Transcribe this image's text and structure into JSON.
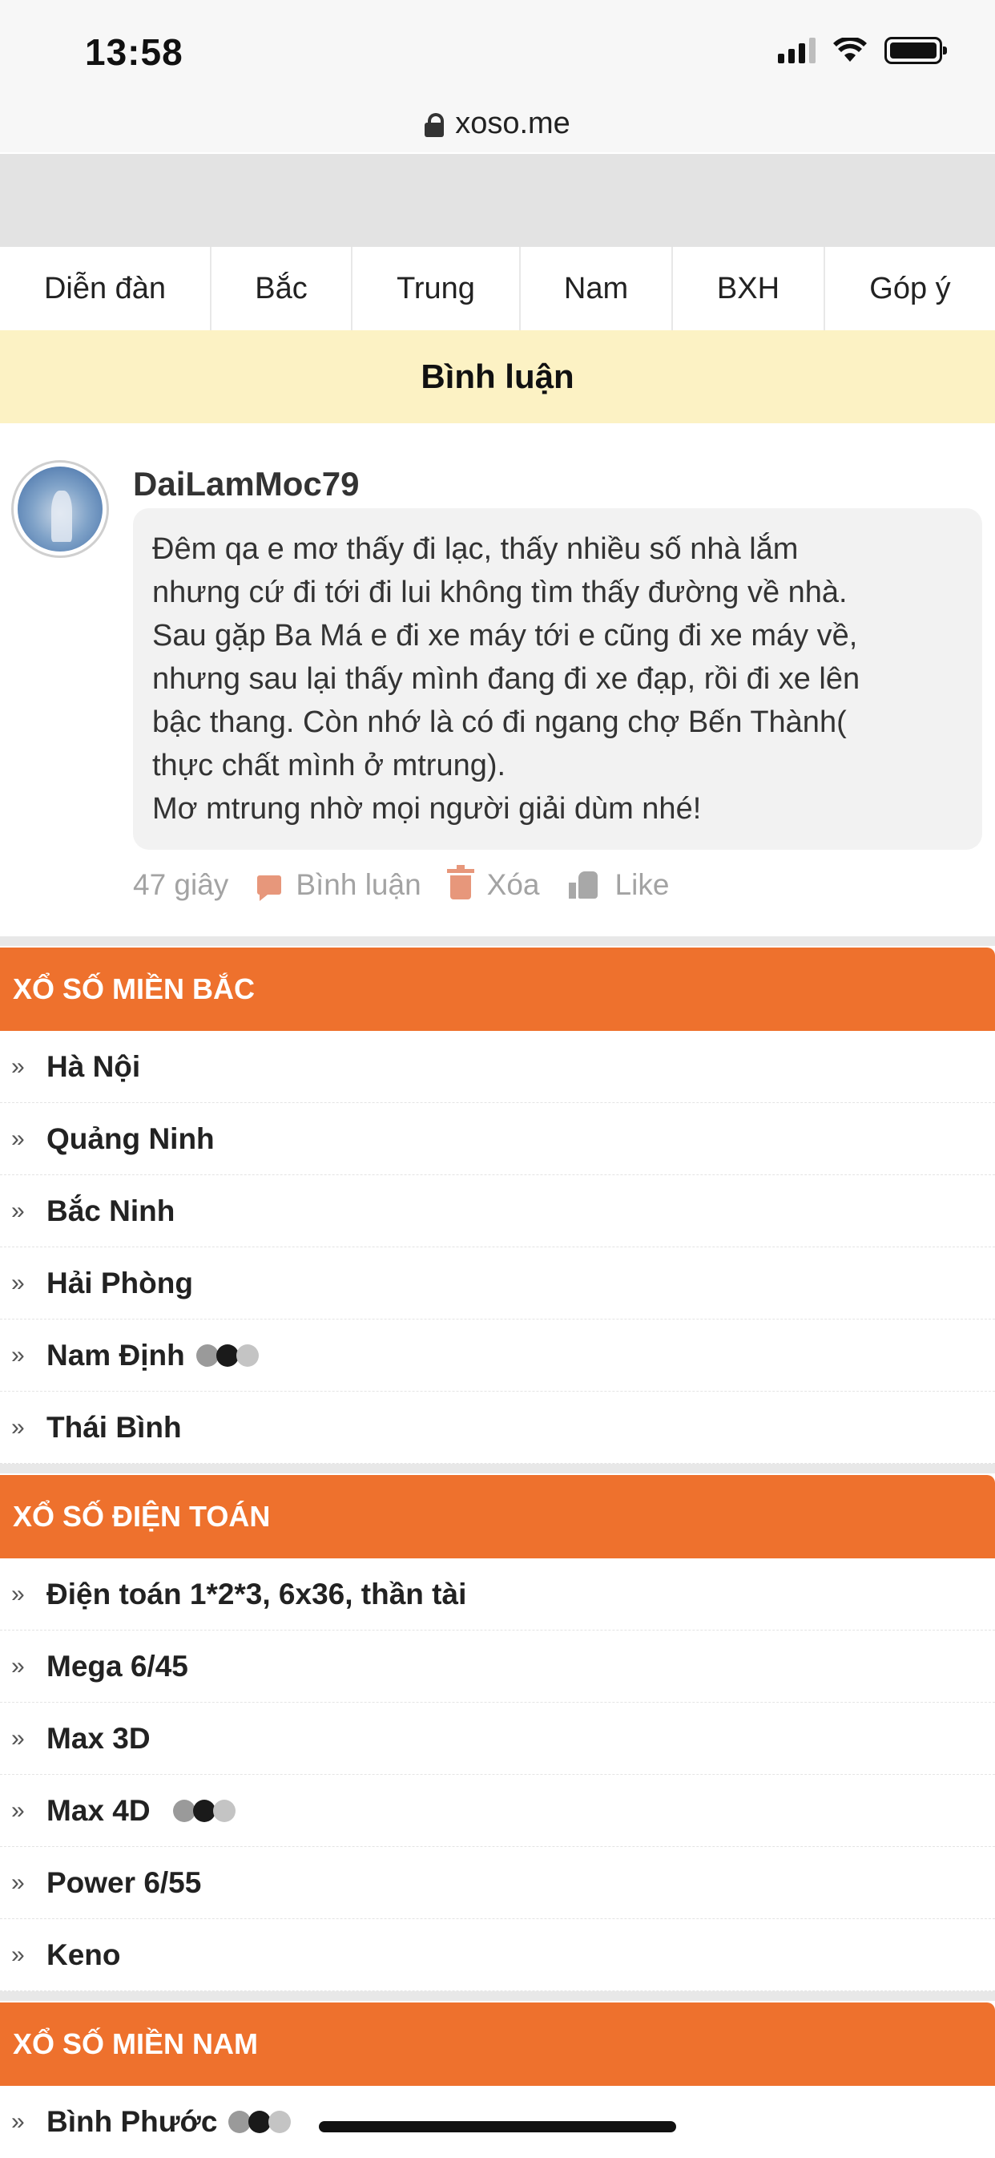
{
  "status_bar": {
    "time": "13:58"
  },
  "browser": {
    "url": "xoso.me"
  },
  "nav": {
    "items": [
      {
        "label": "Diễn đàn"
      },
      {
        "label": "Bắc"
      },
      {
        "label": "Trung"
      },
      {
        "label": "Nam"
      },
      {
        "label": "BXH"
      },
      {
        "label": "Góp ý"
      }
    ]
  },
  "section_title": "Bình luận",
  "comment": {
    "username": "DaiLamMoc79",
    "text": "Đêm qa e mơ thấy đi lạc, thấy nhiều số nhà lắm\nnhưng cứ đi tới đi lui không tìm thấy đường về nhà.\nSau gặp Ba Má e đi xe máy tới e cũng đi xe máy về,\nnhưng sau lại thấy mình đang đi xe đạp, rồi đi xe lên\nbậc thang. Còn nhớ là có đi ngang chợ Bến Thành(\nthực chất mình ở mtrung).\nMơ mtrung nhờ mọi người giải dùm nhé!",
    "time_ago": "47 giây",
    "reply_label": "Bình luận",
    "delete_label": "Xóa",
    "like_label": "Like",
    "icon_colors": {
      "action": "#e7977b",
      "like": "#a8a8a8"
    }
  },
  "sections": [
    {
      "title": "XỔ SỐ MIỀN BẮC",
      "items": [
        {
          "label": "Hà Nội",
          "live": false
        },
        {
          "label": "Quảng Ninh",
          "live": false
        },
        {
          "label": "Bắc Ninh",
          "live": false
        },
        {
          "label": "Hải Phòng",
          "live": false
        },
        {
          "label": "Nam Định",
          "live": true
        },
        {
          "label": "Thái Bình",
          "live": false
        }
      ]
    },
    {
      "title": "XỔ SỐ ĐIỆN TOÁN",
      "items": [
        {
          "label": "Điện toán 1*2*3, 6x36, thần tài",
          "live": false
        },
        {
          "label": "Mega 6/45",
          "live": false
        },
        {
          "label": "Max 3D",
          "live": false
        },
        {
          "label": "Max 4D",
          "live": true
        },
        {
          "label": "Power 6/55",
          "live": false
        },
        {
          "label": "Keno",
          "live": false
        }
      ]
    },
    {
      "title": "XỔ SỐ MIỀN NAM",
      "items": [
        {
          "label": "Bình Phước",
          "live": true
        }
      ]
    }
  ],
  "colors": {
    "accent": "#ee712d",
    "title_band": "#fcf2c4"
  },
  "icons": {
    "chevron": "»"
  }
}
